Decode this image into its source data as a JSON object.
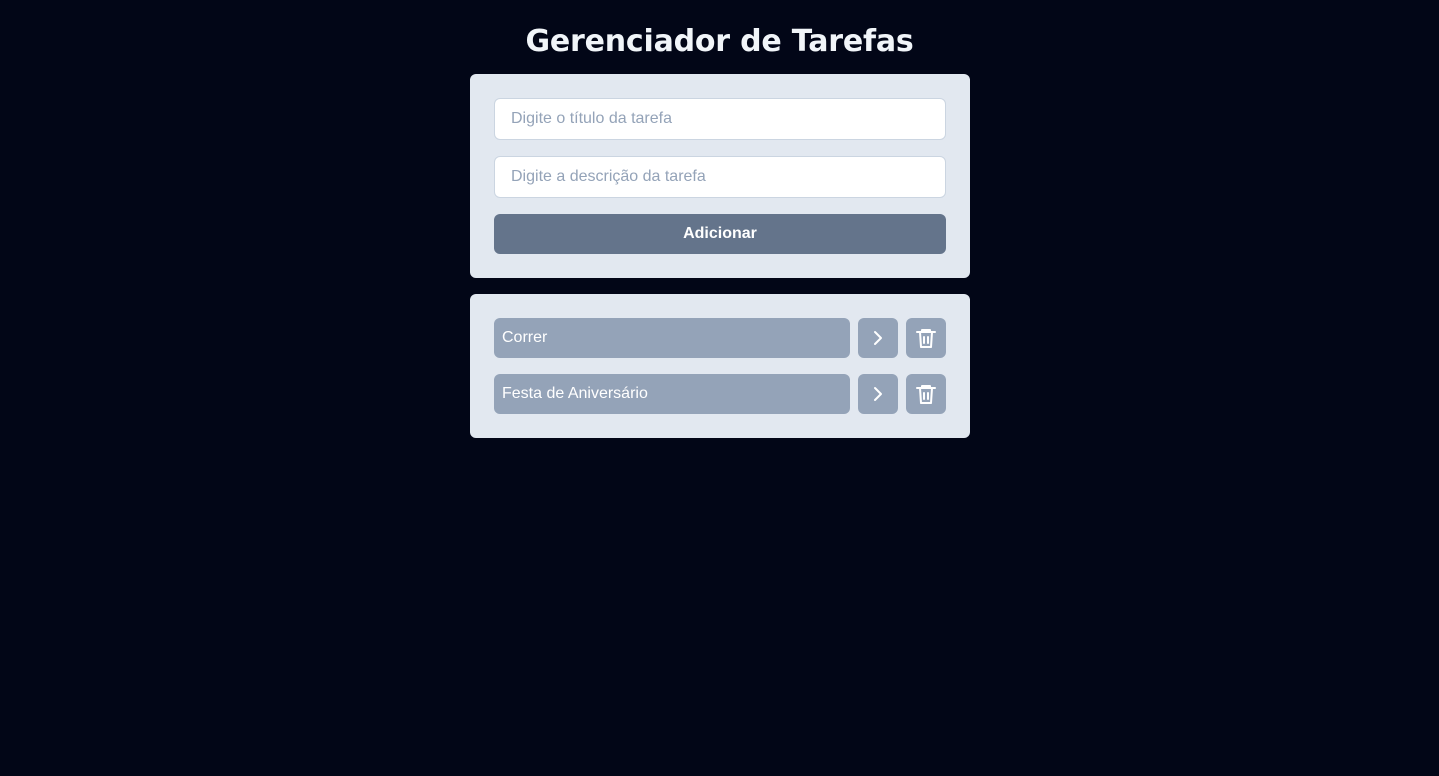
{
  "header": {
    "title": "Gerenciador de Tarefas"
  },
  "form": {
    "title_placeholder": "Digite o título da tarefa",
    "title_value": "",
    "description_placeholder": "Digite a descrição da tarefa",
    "description_value": "",
    "add_label": "Adicionar"
  },
  "tasks": [
    {
      "title": "Correr",
      "open_icon": "chevron-right-icon",
      "delete_icon": "trash-icon"
    },
    {
      "title": "Festa de Aniversário",
      "open_icon": "chevron-right-icon",
      "delete_icon": "trash-icon"
    }
  ],
  "colors": {
    "background": "#020617",
    "title_text": "#f1f5f9",
    "card": "#e2e8f0",
    "input_background": "#ffffff",
    "placeholder": "#94a3b8",
    "primary_button": "#64748b",
    "task_item": "#94a3b8",
    "button_text": "#ffffff"
  }
}
